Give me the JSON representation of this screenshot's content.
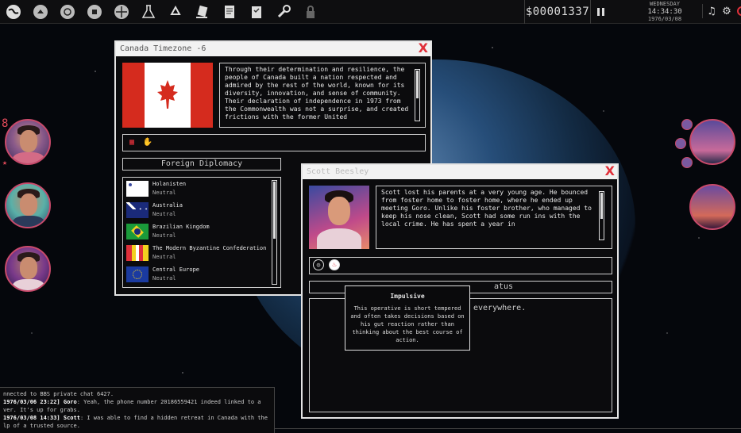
{
  "topbar": {
    "icons": [
      "globe-icon",
      "home-globe-icon",
      "radar-globe-icon",
      "satellite-globe-icon",
      "globe-network-icon",
      "flask-icon",
      "recycle-icon",
      "hand-card-icon",
      "document-icon",
      "clipboard-icon",
      "wrench-icon",
      "lock-icon"
    ],
    "money": "$00001337",
    "day": "WEDNESDAY",
    "time": "14:34:30",
    "date": "1976/03/08"
  },
  "canada_window": {
    "title": "Canada Timezone -6",
    "description": "Through their determination and resilience, the people of Canada built a nation respected and admired by the rest of the world, known for its diversity, innovation, and sense of community. Their declaration of independence in 1973 from the Commonwealth was not a surprise, and created frictions with the former United",
    "section_header": "Foreign Diplomacy",
    "diplomacy": [
      {
        "name": "Holanisten",
        "status": "Neutral"
      },
      {
        "name": "Australia",
        "status": "Neutral"
      },
      {
        "name": "Brazilian Kingdom",
        "status": "Neutral"
      },
      {
        "name": "The Modern Byzantine Confederation",
        "status": "Neutral"
      },
      {
        "name": "Central Europe",
        "status": "Neutral"
      }
    ]
  },
  "scott_window": {
    "title": "Scott Beesley",
    "bio": "Scott lost his parents at a very young age. He bounced from foster home to foster home, where he ended up meeting Goro. Unlike his foster brother, who managed to keep his nose clean, Scott had some run ins with the local crime. He has spent a year in",
    "status_header_visible": "atus",
    "status_text_visible": "everywhere."
  },
  "tooltip": {
    "title": "Impulsive",
    "body": "This operative is short tempered and often takes decisions based on his gut reaction rather than thinking about the best course of action."
  },
  "chat": {
    "line1": "nnected to BBS private chat 6427.",
    "line2_time": "1976/03/06 23:22]",
    "line2_name": "Goro",
    "line2_text": ": Yeah, the phone number 20186559421 indeed linked to a",
    "line3": "ver. It's up for grabs.",
    "line4_time": "1976/03/08 14:33]",
    "line4_name": "Scott",
    "line4_text": ": I was able to find a hidden retreat in Canada with the",
    "line5": "lp of a trusted source."
  },
  "left_badge": "8",
  "colors": {
    "accent_red": "#e0303a",
    "portrait_border": "#c94a6b"
  }
}
